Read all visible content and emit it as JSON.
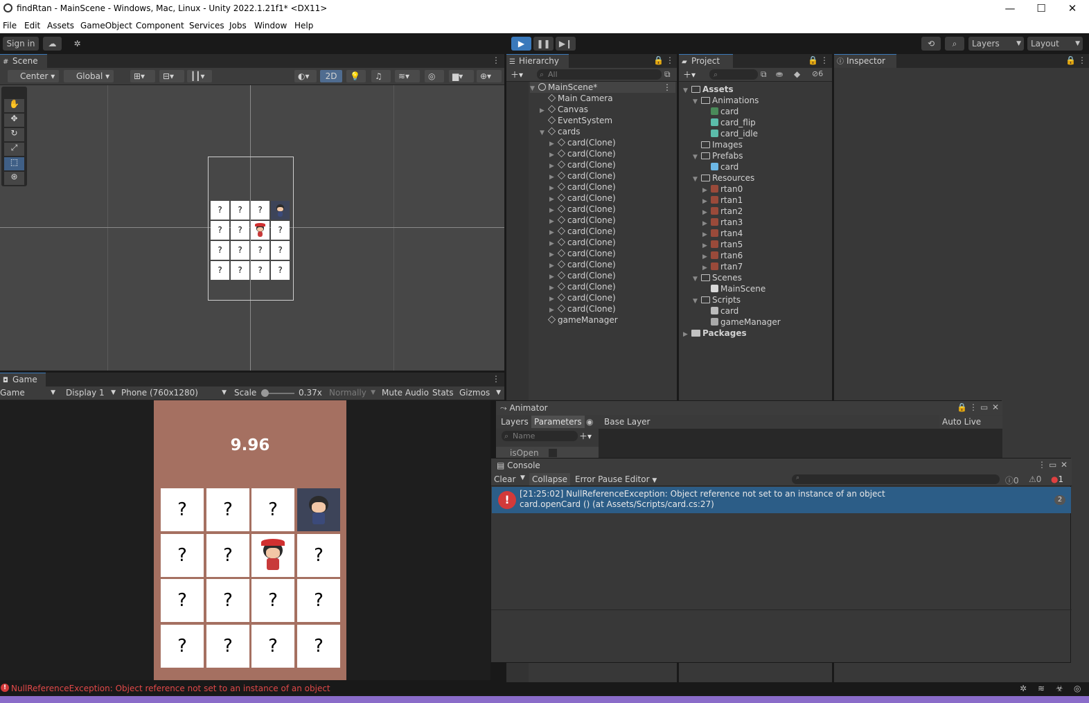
{
  "window": {
    "title": "findRtan - MainScene - Windows, Mac, Linux - Unity 2022.1.21f1* <DX11>",
    "controls": [
      "minimize-icon",
      "maximize-icon",
      "close-icon"
    ]
  },
  "menu": [
    "File",
    "Edit",
    "Assets",
    "GameObject",
    "Component",
    "Services",
    "Jobs",
    "Window",
    "Help"
  ],
  "toolbar": {
    "sign_in": "Sign in",
    "layers": "Layers",
    "layout": "Layout"
  },
  "scene": {
    "tab": "Scene",
    "pivot": "Center",
    "space": "Global",
    "mode_2d": "2D",
    "mini_cards": [
      "?",
      "?",
      "?",
      "",
      "?",
      "?",
      "",
      "?",
      "?",
      "?",
      "?",
      "?",
      "?",
      "?",
      "?",
      "?"
    ]
  },
  "game": {
    "tab": "Game",
    "view": "Game",
    "display": "Display 1",
    "resolution": "Phone (760x1280)",
    "scale_label": "Scale",
    "scale_value": "0.37x",
    "mode": "Normally",
    "mute_audio": "Mute Audio",
    "stats": "Stats",
    "gizmos": "Gizmos",
    "timer": "9.96",
    "cards": [
      "?",
      "?",
      "?",
      "",
      "?",
      "?",
      "",
      "?",
      "?",
      "?",
      "?",
      "?",
      "?",
      "?",
      "?",
      "?"
    ],
    "background_color": "#a57061"
  },
  "hierarchy": {
    "tab": "Hierarchy",
    "search_placeholder": "All",
    "scene_name": "MainScene*",
    "items": [
      {
        "label": "Main Camera",
        "depth": 1,
        "arrow": ""
      },
      {
        "label": "Canvas",
        "depth": 1,
        "arrow": "▶"
      },
      {
        "label": "EventSystem",
        "depth": 1,
        "arrow": ""
      },
      {
        "label": "cards",
        "depth": 1,
        "arrow": "▼"
      },
      {
        "label": "card(Clone)",
        "depth": 2,
        "arrow": "▶"
      },
      {
        "label": "card(Clone)",
        "depth": 2,
        "arrow": "▶"
      },
      {
        "label": "card(Clone)",
        "depth": 2,
        "arrow": "▶"
      },
      {
        "label": "card(Clone)",
        "depth": 2,
        "arrow": "▶"
      },
      {
        "label": "card(Clone)",
        "depth": 2,
        "arrow": "▶"
      },
      {
        "label": "card(Clone)",
        "depth": 2,
        "arrow": "▶"
      },
      {
        "label": "card(Clone)",
        "depth": 2,
        "arrow": "▶"
      },
      {
        "label": "card(Clone)",
        "depth": 2,
        "arrow": "▶"
      },
      {
        "label": "card(Clone)",
        "depth": 2,
        "arrow": "▶"
      },
      {
        "label": "card(Clone)",
        "depth": 2,
        "arrow": "▶"
      },
      {
        "label": "card(Clone)",
        "depth": 2,
        "arrow": "▶"
      },
      {
        "label": "card(Clone)",
        "depth": 2,
        "arrow": "▶"
      },
      {
        "label": "card(Clone)",
        "depth": 2,
        "arrow": "▶"
      },
      {
        "label": "card(Clone)",
        "depth": 2,
        "arrow": "▶"
      },
      {
        "label": "card(Clone)",
        "depth": 2,
        "arrow": "▶"
      },
      {
        "label": "card(Clone)",
        "depth": 2,
        "arrow": "▶"
      },
      {
        "label": "gameManager",
        "depth": 1,
        "arrow": ""
      }
    ]
  },
  "project": {
    "tab": "Project",
    "hidden_count": "6",
    "items": [
      {
        "label": "Assets",
        "depth": 0,
        "arrow": "▼",
        "icon": "folder-open",
        "bold": true
      },
      {
        "label": "Animations",
        "depth": 1,
        "arrow": "▼",
        "icon": "folder-open"
      },
      {
        "label": "card",
        "depth": 2,
        "arrow": "",
        "icon": "animator"
      },
      {
        "label": "card_flip",
        "depth": 2,
        "arrow": "",
        "icon": "anim"
      },
      {
        "label": "card_idle",
        "depth": 2,
        "arrow": "",
        "icon": "anim"
      },
      {
        "label": "Images",
        "depth": 1,
        "arrow": "",
        "icon": "folder-empty"
      },
      {
        "label": "Prefabs",
        "depth": 1,
        "arrow": "▼",
        "icon": "folder-open"
      },
      {
        "label": "card",
        "depth": 2,
        "arrow": "",
        "icon": "prefab"
      },
      {
        "label": "Resources",
        "depth": 1,
        "arrow": "▼",
        "icon": "folder-open"
      },
      {
        "label": "rtan0",
        "depth": 2,
        "arrow": "▶",
        "icon": "sprite"
      },
      {
        "label": "rtan1",
        "depth": 2,
        "arrow": "▶",
        "icon": "sprite"
      },
      {
        "label": "rtan2",
        "depth": 2,
        "arrow": "▶",
        "icon": "sprite"
      },
      {
        "label": "rtan3",
        "depth": 2,
        "arrow": "▶",
        "icon": "sprite"
      },
      {
        "label": "rtan4",
        "depth": 2,
        "arrow": "▶",
        "icon": "sprite"
      },
      {
        "label": "rtan5",
        "depth": 2,
        "arrow": "▶",
        "icon": "sprite"
      },
      {
        "label": "rtan6",
        "depth": 2,
        "arrow": "▶",
        "icon": "sprite"
      },
      {
        "label": "rtan7",
        "depth": 2,
        "arrow": "▶",
        "icon": "sprite"
      },
      {
        "label": "Scenes",
        "depth": 1,
        "arrow": "▼",
        "icon": "folder-open"
      },
      {
        "label": "MainScene",
        "depth": 2,
        "arrow": "",
        "icon": "scene"
      },
      {
        "label": "Scripts",
        "depth": 1,
        "arrow": "▼",
        "icon": "folder-open"
      },
      {
        "label": "card",
        "depth": 2,
        "arrow": "",
        "icon": "script"
      },
      {
        "label": "gameManager",
        "depth": 2,
        "arrow": "",
        "icon": "gear"
      },
      {
        "label": "Packages",
        "depth": 0,
        "arrow": "▶",
        "icon": "folder",
        "bold": true
      }
    ]
  },
  "inspector": {
    "tab": "Inspector"
  },
  "animator": {
    "tab": "Animator",
    "layers": "Layers",
    "parameters": "Parameters",
    "base_layer": "Base Layer",
    "auto_live_link": "Auto Live Link",
    "name_placeholder": "Name",
    "param": "isOpen"
  },
  "console": {
    "tab": "Console",
    "clear": "Clear",
    "collapse": "Collapse",
    "error_pause": "Error Pause",
    "editor": "Editor",
    "log_count": "0",
    "warn_count": "0",
    "error_count": "1",
    "entry_line1": "[21:25:02] NullReferenceException: Object reference not set to an instance of an object",
    "entry_line2": "card.openCard () (at Assets/Scripts/card.cs:27)",
    "entry_count": "2"
  },
  "status": {
    "message": "NullReferenceException: Object reference not set to an instance of an object"
  },
  "colors": {
    "accent": "#3a79bb",
    "error": "#d23a3a",
    "selected_row": "#2c5d87"
  }
}
